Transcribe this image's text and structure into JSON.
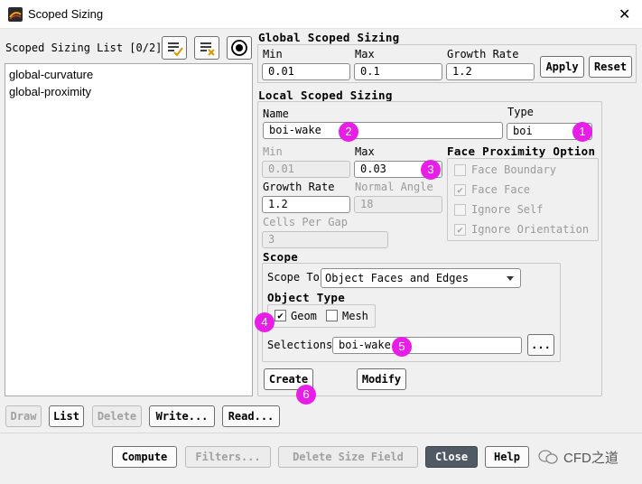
{
  "window": {
    "title": "Scoped Sizing",
    "close_glyph": "✕"
  },
  "list_panel": {
    "title": "Scoped Sizing List [0/2]",
    "items": [
      "global-curvature",
      "global-proximity"
    ]
  },
  "global": {
    "title": "Global Scoped Sizing",
    "min_label": "Min",
    "min_value": "0.01",
    "max_label": "Max",
    "max_value": "0.1",
    "growth_label": "Growth Rate",
    "growth_value": "1.2",
    "apply": "Apply",
    "reset": "Reset"
  },
  "local": {
    "title": "Local Scoped Sizing",
    "name_label": "Name",
    "name_value": "boi-wake",
    "type_label": "Type",
    "type_value": "boi",
    "min_label": "Min",
    "min_value": "0.01",
    "max_label": "Max",
    "max_value": "0.03",
    "growth_label": "Growth Rate",
    "growth_value": "1.2",
    "normal_angle_label": "Normal Angle",
    "normal_angle_value": "18",
    "cells_label": "Cells Per Gap",
    "cells_value": "3",
    "fpo_title": "Face Proximity Option",
    "fpo": [
      {
        "label": "Face Boundary",
        "checked": false
      },
      {
        "label": "Face Face",
        "checked": true
      },
      {
        "label": "Ignore Self",
        "checked": false
      },
      {
        "label": "Ignore Orientation",
        "checked": true
      }
    ],
    "scope_title": "Scope",
    "scope_to_label": "Scope To",
    "scope_to_value": "Object Faces and Edges",
    "object_type_title": "Object Type",
    "geom_label": "Geom",
    "geom_checked": true,
    "mesh_label": "Mesh",
    "mesh_checked": false,
    "selections_label": "Selections",
    "selections_value": "boi-wake",
    "ellipsis": "...",
    "create": "Create",
    "modify": "Modify"
  },
  "badges": [
    "1",
    "2",
    "3",
    "4",
    "5",
    "6"
  ],
  "bottom_left_buttons": [
    "Draw",
    "List",
    "Delete",
    "Write...",
    "Read..."
  ],
  "footer_buttons": [
    "Compute",
    "Filters...",
    "Delete Size Field",
    "Close",
    "Help"
  ],
  "watermark": "CFD之道",
  "colors": {
    "badge": "#e61ee6",
    "close_button": "#505a64"
  }
}
